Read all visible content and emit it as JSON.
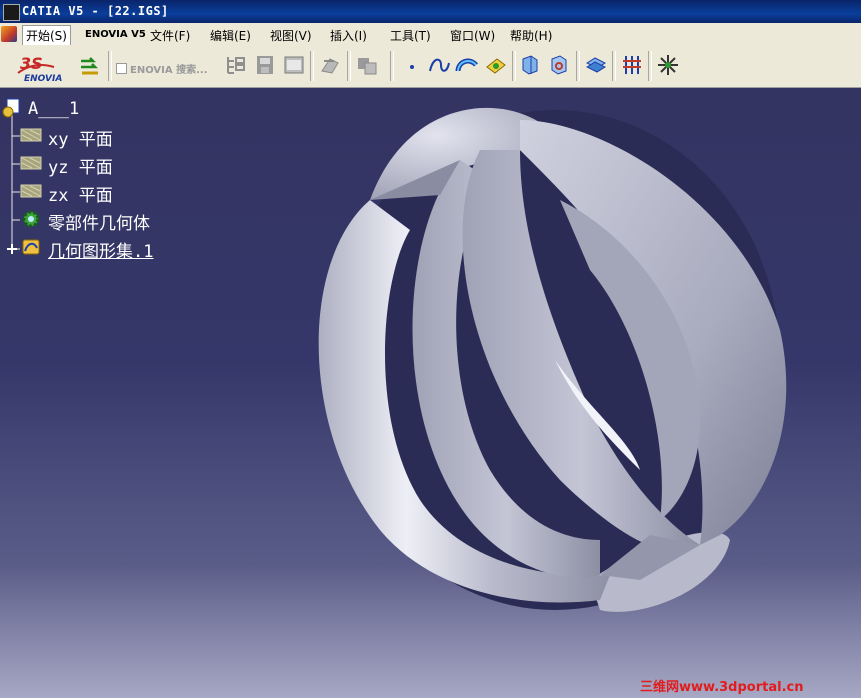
{
  "window": {
    "title": "CATIA V5 - [22.IGS]",
    "app_icon": "catia-app-icon"
  },
  "menu": [
    {
      "label": "开始(S)",
      "active": true
    },
    {
      "label": "ENOVIA V5"
    },
    {
      "label": "文件(F)"
    },
    {
      "label": "编辑(E)"
    },
    {
      "label": "视图(V)"
    },
    {
      "label": "插入(I)"
    },
    {
      "label": "工具(T)"
    },
    {
      "label": "窗口(W)"
    },
    {
      "label": "帮助(H)"
    }
  ],
  "toolbar": {
    "enovia_search": "ENOVIA 搜索...",
    "buttons": [
      "3ds-enovia-logo",
      "enovia-send-icon",
      "tree-expand-icon",
      "save-icon",
      "properties-icon",
      "update-icon",
      "multi-document-icon",
      "point-icon",
      "spline-icon",
      "arc-icon",
      "sketch-icon",
      "extrude-icon",
      "revolve-icon",
      "join-icon",
      "grid-icon",
      "compass-icon"
    ]
  },
  "tree": {
    "root": "A___1",
    "items": [
      {
        "label": "xy 平面",
        "icon": "plane-icon"
      },
      {
        "label": "yz 平面",
        "icon": "plane-icon"
      },
      {
        "label": "zx 平面",
        "icon": "plane-icon"
      },
      {
        "label": "零部件几何体",
        "icon": "part-body-gear-icon"
      },
      {
        "label": "几何图形集.1",
        "icon": "geometrical-set-icon",
        "selected": true
      }
    ]
  },
  "watermark": "三维网www.3dportal.cn",
  "colors": {
    "title_bar": "#0a246a",
    "background_top": "#333461",
    "background_bottom": "#a7a8c4",
    "model": "#c4c5d3",
    "tree_text": "#ffffff",
    "watermark": "#e21c1c"
  }
}
